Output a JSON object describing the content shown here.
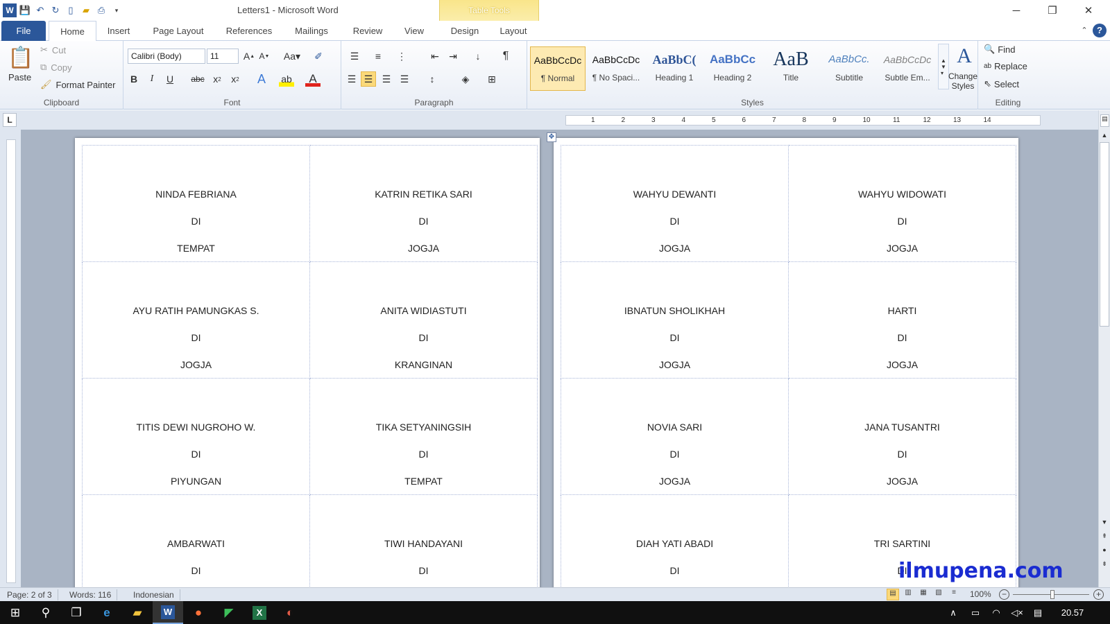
{
  "window": {
    "title": "Letters1  -  Microsoft Word",
    "contextual_tab": "Table Tools",
    "controls": {
      "minimize": "─",
      "restore": "❐",
      "close": "✕"
    }
  },
  "qat": {
    "icons": [
      "word-icon",
      "save-icon",
      "undo-icon",
      "redo-icon",
      "new-doc-icon",
      "open-icon",
      "print-preview-icon",
      "customize-icon"
    ]
  },
  "tabs": [
    {
      "label": "File"
    },
    {
      "label": "Home"
    },
    {
      "label": "Insert"
    },
    {
      "label": "Page Layout"
    },
    {
      "label": "References"
    },
    {
      "label": "Mailings"
    },
    {
      "label": "Review"
    },
    {
      "label": "View"
    },
    {
      "label": "Design"
    },
    {
      "label": "Layout"
    }
  ],
  "ribbon": {
    "clipboard": {
      "label": "Clipboard",
      "paste": "Paste",
      "cut": "Cut",
      "copy": "Copy",
      "format_painter": "Format Painter"
    },
    "font": {
      "label": "Font",
      "name": "Calibri (Body)",
      "size": "11"
    },
    "paragraph": {
      "label": "Paragraph"
    },
    "styles": {
      "label": "Styles",
      "items": [
        {
          "preview": "AaBbCcDc",
          "name": "¶ Normal"
        },
        {
          "preview": "AaBbCcDc",
          "name": "¶ No Spaci..."
        },
        {
          "preview": "AaBbC(",
          "name": "Heading 1"
        },
        {
          "preview": "AaBbCc",
          "name": "Heading 2"
        },
        {
          "preview": "AaB",
          "name": "Title"
        },
        {
          "preview": "AaBbCc.",
          "name": "Subtitle"
        },
        {
          "preview": "AaBbCcDc",
          "name": "Subtle Em..."
        }
      ],
      "change_styles": "Change Styles"
    },
    "editing": {
      "label": "Editing",
      "find": "Find",
      "replace": "Replace",
      "select": "Select"
    }
  },
  "ruler": {
    "numbers": [
      "1",
      "2",
      "3",
      "4",
      "5",
      "6",
      "7",
      "8",
      "9",
      "10",
      "11",
      "12",
      "13",
      "14"
    ]
  },
  "pages": [
    {
      "rows": [
        [
          [
            "NINDA FEBRIANA",
            "DI",
            "TEMPAT"
          ],
          [
            "KATRIN RETIKA SARI",
            "DI",
            "JOGJA"
          ]
        ],
        [
          [
            "AYU RATIH PAMUNGKAS S.",
            "DI",
            "JOGJA"
          ],
          [
            "ANITA WIDIASTUTI",
            "DI",
            "KRANGINAN"
          ]
        ],
        [
          [
            "TITIS DEWI NUGROHO W.",
            "DI",
            "PIYUNGAN"
          ],
          [
            "TIKA SETYANINGSIH",
            "DI",
            "TEMPAT"
          ]
        ],
        [
          [
            "AMBARWATI",
            "DI",
            ""
          ],
          [
            "TIWI HANDAYANI",
            "DI",
            ""
          ]
        ]
      ]
    },
    {
      "rows": [
        [
          [
            "WAHYU DEWANTI",
            "DI",
            "JOGJA"
          ],
          [
            "WAHYU WIDOWATI",
            "DI",
            "JOGJA"
          ]
        ],
        [
          [
            "IBNATUN SHOLIKHAH",
            "DI",
            "JOGJA"
          ],
          [
            "HARTI",
            "DI",
            "JOGJA"
          ]
        ],
        [
          [
            "NOVIA SARI",
            "DI",
            "JOGJA"
          ],
          [
            "JANA TUSANTRI",
            "DI",
            "JOGJA"
          ]
        ],
        [
          [
            "DIAH YATI ABADI",
            "DI",
            ""
          ],
          [
            "TRI SARTINI",
            "DI",
            ""
          ]
        ]
      ]
    }
  ],
  "status": {
    "page": "Page: 2 of 3",
    "words": "Words: 116",
    "language": "Indonesian",
    "zoom": "100%"
  },
  "watermark": "ilmupena.com",
  "taskbar": {
    "time": "20.57"
  }
}
